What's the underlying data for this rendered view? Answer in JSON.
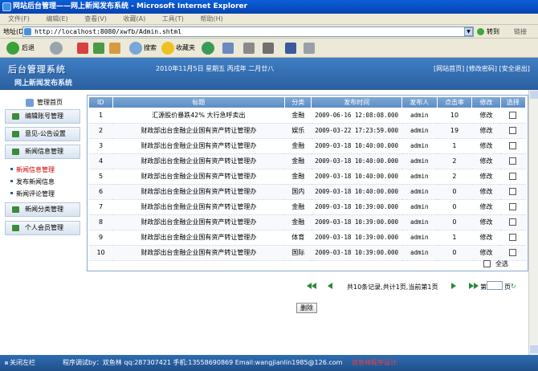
{
  "window": {
    "title": "网站后台管理——网上新闻发布系统 - Microsoft Internet Explorer"
  },
  "menu": [
    "文件(F)",
    "编辑(E)",
    "查看(V)",
    "收藏(A)",
    "工具(T)",
    "帮助(H)"
  ],
  "address": {
    "label": "地址(D)",
    "url": "http://localhost:8080/xwfb/Admin.shtml",
    "go": "转到",
    "links": "链接"
  },
  "toolbar": {
    "back": "后退",
    "search": "搜索",
    "favorites": "收藏夹"
  },
  "banner": {
    "logo": "后台管理系统",
    "subtitle": "网上新闻发布系统",
    "date": "2010年11月5日 星期五 丙戌年 二月廿八",
    "links": [
      "[网站首页]",
      "[修改密码]",
      "[安全退出]"
    ]
  },
  "sidebar": {
    "home": "管理首页",
    "edit_account": "编辑账号管理",
    "notice": "意见-公告设置",
    "news_info": "新闻信息管理",
    "sub_items": [
      "新闻信息管理",
      "发布新闻信息",
      "新闻评论管理"
    ],
    "category": "新闻分类管理",
    "member": "个人会员管理"
  },
  "table": {
    "headers": [
      "ID",
      "标题",
      "分类",
      "发布时间",
      "发布人",
      "点击率",
      "修改",
      "选择"
    ],
    "rows": [
      {
        "id": "1",
        "title": "汇源股价暴跌42% 大行急呼卖出",
        "category": "金融",
        "time": "2009-06-16 12:08:08.000",
        "author": "admin",
        "clicks": "10",
        "edit": "修改"
      },
      {
        "id": "2",
        "title": "财政部出台金融企业国有资产转让管理办",
        "category": "娱乐",
        "time": "2009-03-22 17:23:59.000",
        "author": "admin",
        "clicks": "19",
        "edit": "修改"
      },
      {
        "id": "3",
        "title": "财政部出台金融企业国有资产转让管理办",
        "category": "金融",
        "time": "2009-03-18 10:40:00.000",
        "author": "admin",
        "clicks": "1",
        "edit": "修改"
      },
      {
        "id": "4",
        "title": "财政部出台金融企业国有资产转让管理办",
        "category": "金融",
        "time": "2009-03-18 10:40:00.000",
        "author": "admin",
        "clicks": "2",
        "edit": "修改"
      },
      {
        "id": "5",
        "title": "财政部出台金融企业国有资产转让管理办",
        "category": "金融",
        "time": "2009-03-18 10:40:00.000",
        "author": "admin",
        "clicks": "2",
        "edit": "修改"
      },
      {
        "id": "6",
        "title": "财政部出台金融企业国有资产转让管理办",
        "category": "国内",
        "time": "2009-03-18 10:40:00.000",
        "author": "admin",
        "clicks": "0",
        "edit": "修改"
      },
      {
        "id": "7",
        "title": "财政部出台金融企业国有资产转让管理办",
        "category": "金融",
        "time": "2009-03-18 10:39:00.000",
        "author": "admin",
        "clicks": "0",
        "edit": "修改"
      },
      {
        "id": "8",
        "title": "财政部出台金融企业国有资产转让管理办",
        "category": "金融",
        "time": "2009-03-18 10:39:00.000",
        "author": "admin",
        "clicks": "0",
        "edit": "修改"
      },
      {
        "id": "9",
        "title": "财政部出台金融企业国有资产转让管理办",
        "category": "体育",
        "time": "2009-03-18 10:39:00.000",
        "author": "admin",
        "clicks": "1",
        "edit": "修改"
      },
      {
        "id": "10",
        "title": "财政部出台金融企业国有资产转让管理办",
        "category": "国际",
        "time": "2009-03-18 10:39:00.000",
        "author": "admin",
        "clicks": "0",
        "edit": "修改"
      }
    ],
    "select_all": "全选"
  },
  "pager": {
    "summary": "共10条记录,共计1页,当前第1页",
    "page_prefix": "第",
    "page_suffix": "页"
  },
  "delete_label": "删除",
  "footer": {
    "close": "关闭左栏",
    "info": "程序调试by：双鱼林 qq:287307421 手机:13558690869 Email:wangjianlin1985@126.com",
    "extra": "双鱼林程序设计"
  }
}
